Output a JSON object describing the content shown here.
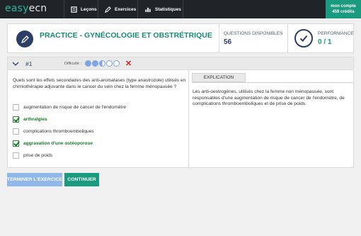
{
  "nav": {
    "logo_part1": "easy",
    "logo_part2": "ecn",
    "items": [
      {
        "label": "Leçons",
        "icon": "book-icon"
      },
      {
        "label": "Exercices",
        "icon": "pencil-icon"
      },
      {
        "label": "Statistiques",
        "icon": "bar-chart-icon"
      }
    ],
    "account_label": "mon compte",
    "account_credits": "459 crédits"
  },
  "header": {
    "title": "PRACTICE - GYNÉCOLOGIE ET OBSTRÉTRIQUE",
    "questions_label": "QUESTIONS DISPONIBLES",
    "questions_value": "56",
    "performance_label": "PERFORMANCE",
    "performance_value": "0 / 1"
  },
  "question": {
    "number": "#1",
    "difficulty_label": "Difficulté :",
    "difficulty_level": 2.5,
    "difficulty_max": 5,
    "result_icon": "cross-icon",
    "text": "Quels sont les effets secondaires des anti-aromatases (type anastrozole) utilisés en chimiothérapie adjuvante dans le cancer du sein chez la femme ménopausée ?",
    "options": [
      {
        "label": "augmentation de risque de cancer de l'endomètre",
        "checked": false,
        "correct": false
      },
      {
        "label": "arthralgies",
        "checked": true,
        "correct": true
      },
      {
        "label": "complications thromboemboliques",
        "checked": false,
        "correct": false
      },
      {
        "label": "aggravation d'une ostéoporose",
        "checked": true,
        "correct": true
      },
      {
        "label": "prise de poids",
        "checked": false,
        "correct": false
      }
    ]
  },
  "explanation": {
    "tab_label": "EXPLICATION",
    "text": "Les anti-oestrogènes, utilisés chez la femme non ménopausée, sont responsables d'une augmentation de risque de cancer de l'endomètre, de complications thromboemboliques et de prise de poids."
  },
  "buttons": {
    "end_label": "TERMINER L'EXERCICE",
    "continue_label": "CONTINUER"
  },
  "colors": {
    "accent": "#1a9a7e",
    "navy": "#2d3e66",
    "correct": "#1d7a2f",
    "error": "#d9211f",
    "end_button": "#8fb8e8"
  }
}
